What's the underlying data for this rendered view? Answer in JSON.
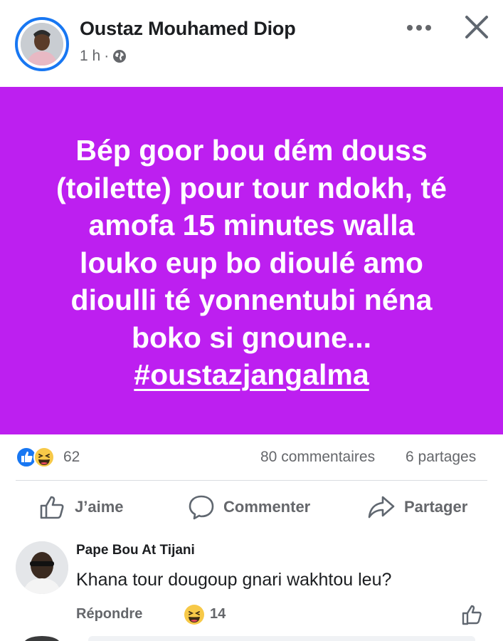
{
  "post": {
    "author": "Oustaz Mouhamed Diop",
    "time": "1 h",
    "separator": "·",
    "audience_icon": "globe-icon",
    "body_lines": [
      "Bép goor bou dém douss",
      "(toilette) pour tour ndokh, té",
      "amofa 15 minutes walla",
      "louko eup bo dioulé amo",
      "dioulli té yonnentubi néna",
      "boko si gnoune..."
    ],
    "hashtag": "#oustazjangalma",
    "background_color": "#bd1ff0"
  },
  "stats": {
    "reaction_icons": [
      "like-icon",
      "haha-icon"
    ],
    "reaction_count": "62",
    "comments": "80 commentaires",
    "shares": "6 partages"
  },
  "actions": {
    "like": "J’aime",
    "comment": "Commenter",
    "share": "Partager"
  },
  "comment": {
    "author": "Pape Bou At Tijani",
    "text": "Khana tour dougoup gnari wakhtou leu?",
    "reply_label": "Répondre",
    "reaction_icon": "haha-icon",
    "reaction_count": "14"
  },
  "colors": {
    "accent": "#1877f2",
    "secondary_text": "#65676b"
  }
}
